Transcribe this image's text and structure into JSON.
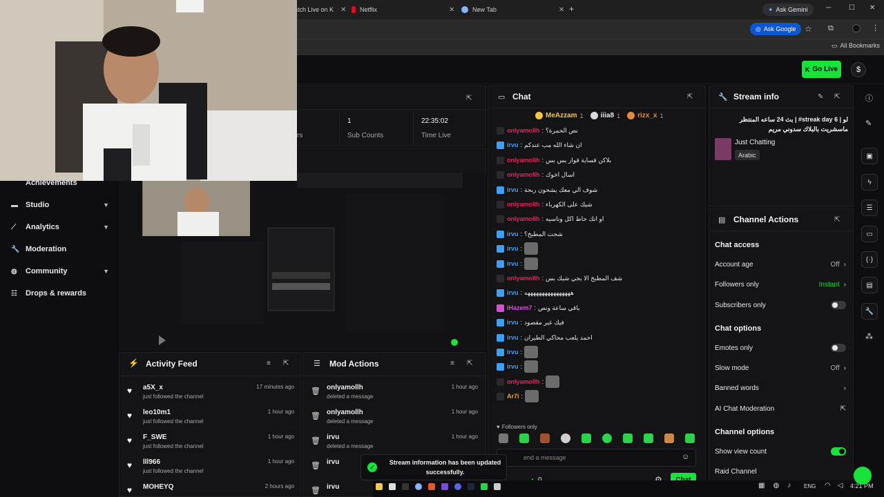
{
  "browser": {
    "tabs": [
      {
        "label": "atch Live on K",
        "favicon_color": "#16e43b"
      },
      {
        "label": "Netflix",
        "favicon_color": "#e50914"
      },
      {
        "label": "New Tab",
        "favicon_color": "#8ab4f8"
      }
    ],
    "new_tab_icon": "plus-icon",
    "ask_gemini": "Ask Gemini",
    "ask_google": "Ask Google",
    "all_bookmarks": "All Bookmarks"
  },
  "topbar": {
    "go_live": "Go Live",
    "wallet_icon": "$"
  },
  "sidebar": {
    "items": [
      {
        "label": "Achievements",
        "icon": "trophy-icon",
        "chevron": false
      },
      {
        "label": "Studio",
        "icon": "studio-icon",
        "chevron": true
      },
      {
        "label": "Analytics",
        "icon": "analytics-icon",
        "chevron": true
      },
      {
        "label": "Moderation",
        "icon": "wrench-icon",
        "chevron": false
      },
      {
        "label": "Community",
        "icon": "globe-icon",
        "chevron": true
      },
      {
        "label": "Drops & rewards",
        "icon": "drops-icon",
        "chevron": false
      }
    ]
  },
  "stats": {
    "partial_label": "rs",
    "sub_counts_value": "1",
    "sub_counts_label": "Sub Counts",
    "time_live_value": "22:35:02",
    "time_live_label": "Time Live"
  },
  "activity_feed": {
    "title": "Activity Feed",
    "rows": [
      {
        "name": "a5X_x",
        "sub": "just followed the channel",
        "time": "17 minutes ago"
      },
      {
        "name": "leo10m1",
        "sub": "just followed the channel",
        "time": "1 hour ago"
      },
      {
        "name": "F_SWE",
        "sub": "just followed the channel",
        "time": "1 hour ago"
      },
      {
        "name": "lll966",
        "sub": "just followed the channel",
        "time": "1 hour ago"
      },
      {
        "name": "MOHEYQ",
        "sub": "",
        "time": "2 hours ago"
      }
    ]
  },
  "mod_actions": {
    "title": "Mod Actions",
    "rows": [
      {
        "name": "onlyamollh",
        "sub": "deleted a message",
        "time": "1 hour ago"
      },
      {
        "name": "onlyamollh",
        "sub": "deleted a message",
        "time": "1 hour ago"
      },
      {
        "name": "irvu",
        "sub": "deleted a message",
        "time": "1 hour ago"
      },
      {
        "name": "irvu",
        "sub": "",
        "time": ""
      },
      {
        "name": "irvu",
        "sub": "",
        "time": ""
      }
    ]
  },
  "chat": {
    "title": "Chat",
    "top_chatters": [
      {
        "name": "MeAzzam",
        "count": "1",
        "color": "#f5c542"
      },
      {
        "name": "iiia8",
        "count": "1",
        "color": "#d9d9d9"
      },
      {
        "name": "rizx_x",
        "count": "1",
        "color": "#e38a3c"
      }
    ],
    "messages": [
      {
        "user": "onlyamollh",
        "color": "#e0245e",
        "text": "نص الحمرة؟"
      },
      {
        "user": "irvu",
        "color": "#3aa0ff",
        "text": "ان شاء الله مب عندكم"
      },
      {
        "user": "onlyamollh",
        "color": "#e0245e",
        "text": "بلاكن قساية قواز بس بس"
      },
      {
        "user": "onlyamollh",
        "color": "#e0245e",
        "text": "اسال اخوك"
      },
      {
        "user": "irvu",
        "color": "#3aa0ff",
        "text": "شوف الي معك يشحون ربحة"
      },
      {
        "user": "onlyamollh",
        "color": "#e0245e",
        "text": "شيك على الكهرباء"
      },
      {
        "user": "onlyamollh",
        "color": "#e0245e",
        "text": "او انك حاط اكل وناسيه"
      },
      {
        "user": "irvu",
        "color": "#3aa0ff",
        "text": "شحت المطبخ؟"
      },
      {
        "user": "irvu",
        "color": "#3aa0ff",
        "text": ""
      },
      {
        "user": "irvu",
        "color": "#3aa0ff",
        "text": ""
      },
      {
        "user": "onlyamollh",
        "color": "#e0245e",
        "text": "شف المطبخ الا يجي شيك بس"
      },
      {
        "user": "irvu",
        "color": "#3aa0ff",
        "text": "ههههههههههههههههه"
      },
      {
        "user": "lHazem7",
        "color": "#d94dd9",
        "text": "باقي ساعة ونص"
      },
      {
        "user": "irvu",
        "color": "#3aa0ff",
        "text": "فيك غير مقصود"
      },
      {
        "user": "irvu",
        "color": "#3aa0ff",
        "text": "احمد يلعب محاكي الطيران"
      },
      {
        "user": "irvu",
        "color": "#3aa0ff",
        "text": ""
      },
      {
        "user": "irvu",
        "color": "#3aa0ff",
        "text": ""
      },
      {
        "user": "onlyamollh",
        "color": "#e0245e",
        "text": ""
      },
      {
        "user": "Ar7i",
        "color": "#f0a33c",
        "text": ""
      }
    ],
    "followers_only": "Followers only",
    "input_placeholder": "end a message",
    "points": "0",
    "send": "Chat"
  },
  "stream_info": {
    "title": "Stream info",
    "stream_title": "لو | 6 streak day# | بث 24 ساعه المنتظر ماسشريت بالبلاك سدوني مريم",
    "category": "Just Chatting",
    "language": "Arabic"
  },
  "channel_actions": {
    "title": "Channel Actions",
    "chat_access": "Chat access",
    "account_age": "Account age",
    "account_age_value": "Off",
    "followers_only": "Followers only",
    "followers_only_value": "Instant",
    "subscribers_only": "Subscribers only",
    "chat_options": "Chat options",
    "emotes_only": "Emotes only",
    "slow_mode": "Slow mode",
    "slow_mode_value": "Off",
    "banned_words": "Banned words",
    "ai_moderation": "AI Chat Moderation",
    "channel_options": "Channel options",
    "show_view_count": "Show view count",
    "raid_channel": "Raid Channel"
  },
  "toast": {
    "line1": "Stream information has been updated",
    "line2": "successfully."
  },
  "taskbar": {
    "lang": "ENG",
    "time": "4:21 PM"
  },
  "colors": {
    "accent": "#16e43b",
    "panel": "#141416",
    "background": "#0e0e10"
  }
}
